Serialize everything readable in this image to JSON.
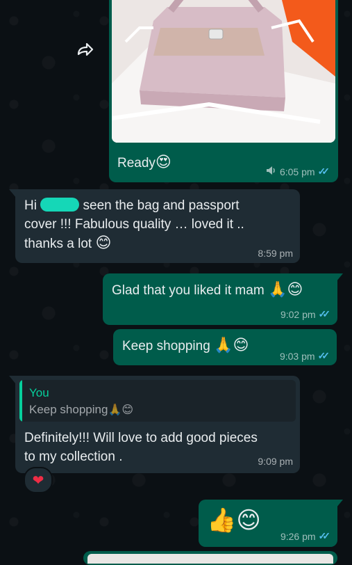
{
  "messages": {
    "m1": {
      "text": "Ready",
      "emoji": "😍",
      "time": "6:05 pm",
      "ticks": "✓✓"
    },
    "m2": {
      "text_a": "Hi",
      "text_b": "seen the bag and passport",
      "text_c": "cover !!! Fabulous quality … loved it ..",
      "text_d": "thanks a lot",
      "emoji": "😊",
      "time": "8:59 pm"
    },
    "m3": {
      "text": "Glad that you liked it mam",
      "emoji": "🙏😊",
      "time": "9:02 pm",
      "ticks": "✓✓"
    },
    "m4": {
      "text": "Keep shopping",
      "emoji": "🙏😊",
      "time": "9:03 pm",
      "ticks": "✓✓"
    },
    "m5": {
      "quote_author": "You",
      "quote_text": "Keep shopping",
      "quote_emoji": "🙏😊",
      "text_a": "Definitely!!! Will love to add good pieces",
      "text_b": "to my collection .",
      "time": "9:09 pm",
      "reaction": "❤"
    },
    "m6": {
      "emoji": "👍😊",
      "time": "9:26 pm",
      "ticks": "✓✓"
    }
  },
  "icons": {
    "forward": "forward-icon",
    "speaker": "speaker-icon"
  },
  "colors": {
    "outgoing": "#005c4b",
    "incoming": "#1f2c34",
    "read_ticks": "#53bdeb",
    "quote_bar": "#06cf9c"
  }
}
